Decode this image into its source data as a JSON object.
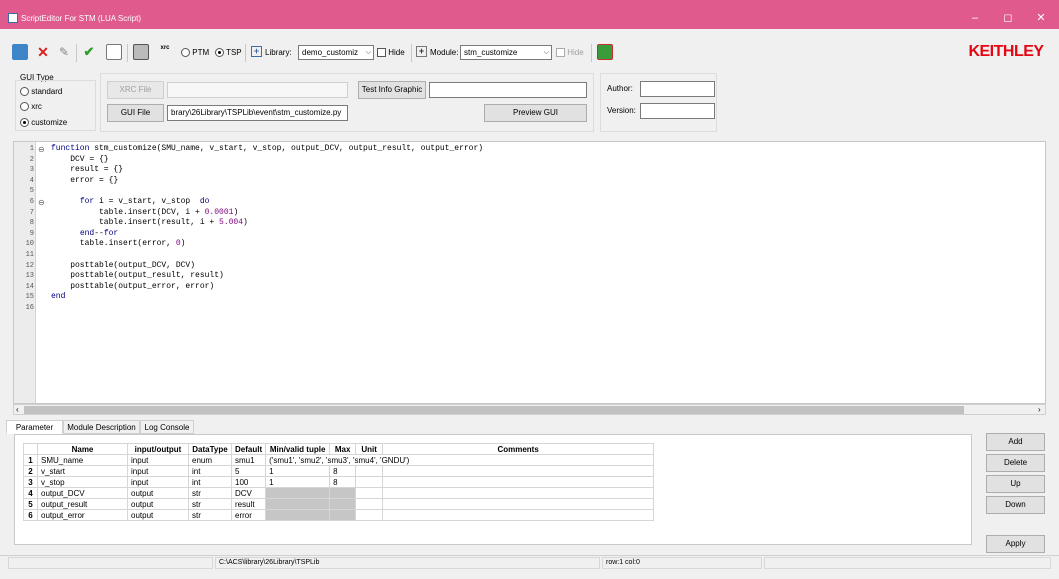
{
  "window": {
    "title": "ScriptEditor For STM (LUA Script)",
    "minimize": "–",
    "maximize": "◻",
    "close": "✕"
  },
  "toolbar": {
    "ptm_label": "PTM",
    "tsp_label": "TSP",
    "library_label": "Library:",
    "library_value": "demo_customiz",
    "library_hide": "Hide",
    "module_label": "Module:",
    "module_value": "stm_customize",
    "module_hide": "Hide",
    "xrc_icon_text": "xrc",
    "brand": "KEITHLEY"
  },
  "gui_type": {
    "title": "GUI Type",
    "options": [
      "standard",
      "xrc",
      "customize"
    ],
    "selected": "customize"
  },
  "files": {
    "xrc_button": "XRC File",
    "xrc_value": "",
    "gui_button": "GUI File",
    "gui_value": "brary\\26Library\\TSPLib\\event\\stm_customize.py",
    "test_info_button": "Test Info Graphic",
    "test_info_value": "",
    "preview_button": "Preview GUI"
  },
  "meta": {
    "author_label": "Author:",
    "author_value": "",
    "version_label": "Version:",
    "version_value": ""
  },
  "editor": {
    "lines": [
      {
        "n": "1",
        "fold": "⊖",
        "code": "function stm_customize(SMU_name, v_start, v_stop, output_DCV, output_result, output_error)"
      },
      {
        "n": "2",
        "fold": "",
        "code": "    DCV = {}"
      },
      {
        "n": "3",
        "fold": "",
        "code": "    result = {}"
      },
      {
        "n": "4",
        "fold": "",
        "code": "    error = {}"
      },
      {
        "n": "5",
        "fold": "",
        "code": ""
      },
      {
        "n": "6",
        "fold": "⊖",
        "code": "      for i = v_start, v_stop  do"
      },
      {
        "n": "7",
        "fold": "",
        "code": "          table.insert(DCV, i + 0.0001)"
      },
      {
        "n": "8",
        "fold": "",
        "code": "          table.insert(result, i + 5.004)"
      },
      {
        "n": "9",
        "fold": "",
        "code": "      end--for"
      },
      {
        "n": "10",
        "fold": "",
        "code": "      table.insert(error, 0)"
      },
      {
        "n": "11",
        "fold": "",
        "code": ""
      },
      {
        "n": "12",
        "fold": "",
        "code": "    posttable(output_DCV, DCV)"
      },
      {
        "n": "13",
        "fold": "",
        "code": "    posttable(output_result, result)"
      },
      {
        "n": "14",
        "fold": "",
        "code": "    posttable(output_error, error)"
      },
      {
        "n": "15",
        "fold": "",
        "code": "end"
      },
      {
        "n": "16",
        "fold": "",
        "code": ""
      }
    ],
    "scroll_left": "‹",
    "scroll_right": "›"
  },
  "tabs": [
    "Parameter",
    "Module Description",
    "Log Console"
  ],
  "active_tab": "Parameter",
  "params": {
    "columns": [
      "Name",
      "input/output",
      "DataType",
      "Default",
      "Min/valid tuple",
      "Max",
      "Unit",
      "Comments"
    ],
    "rows": [
      {
        "n": "1",
        "name": "SMU_name",
        "io": "input",
        "type": "enum",
        "default": "smu1",
        "min": "('smu1', 'smu2', 'smu3', 'smu4', 'GNDU')",
        "max": "",
        "unit": "",
        "comments": ""
      },
      {
        "n": "2",
        "name": "v_start",
        "io": "input",
        "type": "int",
        "default": "5",
        "min": "1",
        "max": "8",
        "unit": "",
        "comments": ""
      },
      {
        "n": "3",
        "name": "v_stop",
        "io": "input",
        "type": "int",
        "default": "100",
        "min": "1",
        "max": "8",
        "unit": "",
        "comments": ""
      },
      {
        "n": "4",
        "name": "output_DCV",
        "io": "output",
        "type": "str",
        "default": "DCV",
        "min": "",
        "max": "",
        "unit": "",
        "comments": ""
      },
      {
        "n": "5",
        "name": "output_result",
        "io": "output",
        "type": "str",
        "default": "result",
        "min": "",
        "max": "",
        "unit": "",
        "comments": ""
      },
      {
        "n": "6",
        "name": "output_error",
        "io": "output",
        "type": "str",
        "default": "error",
        "min": "",
        "max": "",
        "unit": "",
        "comments": ""
      }
    ]
  },
  "side_buttons": {
    "add": "Add",
    "delete": "Delete",
    "up": "Up",
    "down": "Down",
    "apply": "Apply"
  },
  "status": {
    "path": "C:\\ACS\\library\\26Library\\TSPLib",
    "position": "row:1  col:0"
  },
  "colors": {
    "titlebar": "#e05a8e",
    "keyword": "#00007f",
    "number": "#7f007f",
    "brand": "#e30613"
  }
}
